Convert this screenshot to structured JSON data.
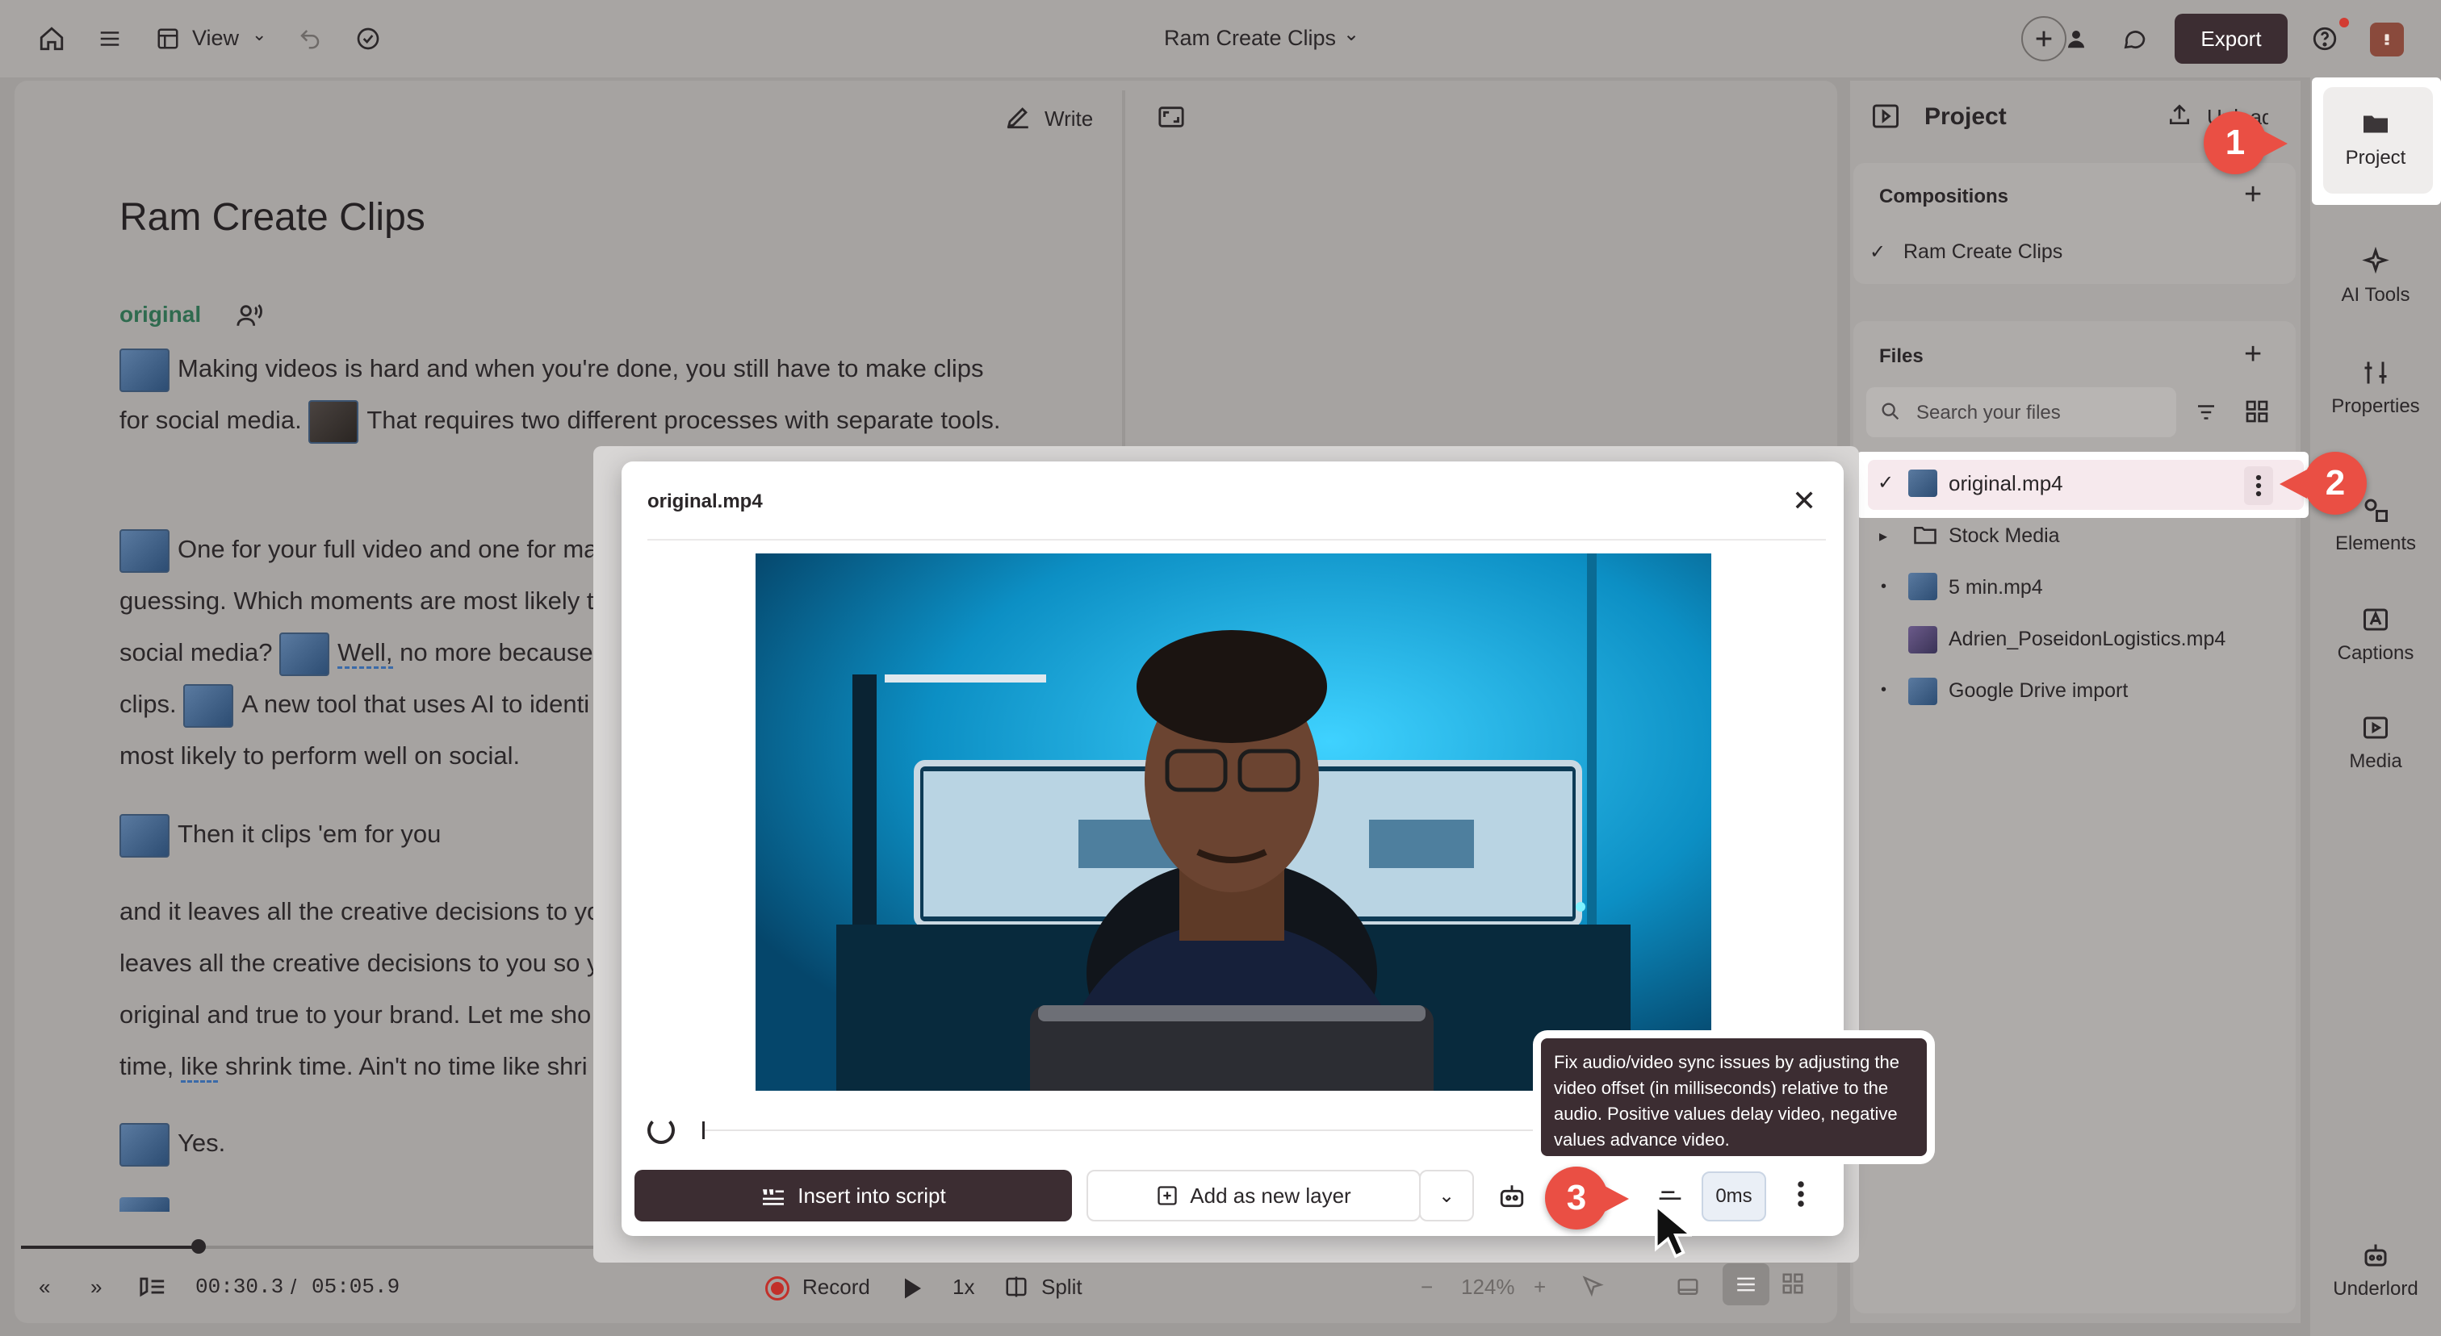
{
  "topbar": {
    "view_label": "View",
    "doc_title": "Ram Create Clips",
    "export_label": "Export"
  },
  "editor": {
    "write_label": "Write",
    "title": "Ram Create Clips",
    "speaker_label": "original",
    "p1_a": "Making videos is hard and when you're done, you still have to make clips for social media.",
    "p1_b": "That requires two different processes with separate tools.",
    "p2_a": "One for your full video and one for ma",
    "p2_b": "guessing. Which moments are most likely t",
    "p2_c": "social media?",
    "p2_d": "Well,",
    "p2_e": "no more because",
    "p2_f": "clips.",
    "p2_g": "A new tool that uses AI to identi",
    "p2_h": "most likely to perform well on social.",
    "p3": "Then it clips 'em for you",
    "p4_a": "and it leaves all the creative decisions to yo",
    "p4_b": "leaves all the creative decisions to you so y",
    "p4_c": "original and true to your brand. Let me sho",
    "p4_d": "time,",
    "p4_e": "like",
    "p4_f": "shrink time. Ain't no time like shri",
    "p5": "Yes."
  },
  "transport": {
    "current_time": "00:30.3",
    "separator": "/",
    "total_time": "05:05.9",
    "record_label": "Record",
    "speed_label": "1x",
    "split_label": "Split",
    "zoom_label": "124%",
    "progress": 0.098
  },
  "project": {
    "header": "Project",
    "upload_label": "Upload",
    "compositions_header": "Compositions",
    "compositions": [
      "Ram Create Clips"
    ],
    "files_header": "Files",
    "search_placeholder": "Search your files",
    "files": [
      {
        "name": "original.mp4"
      },
      {
        "name": "Stock Media"
      },
      {
        "name": "5 min.mp4"
      },
      {
        "name": "Adrien_PoseidonLogistics.mp4"
      },
      {
        "name": "Google Drive import"
      }
    ]
  },
  "sidebar": {
    "items": [
      "Project",
      "AI Tools",
      "Properties",
      "Elements",
      "Captions",
      "Media",
      "Underlord"
    ]
  },
  "modal": {
    "title": "original.mp4",
    "insert_label": "Insert into script",
    "add_layer_label": "Add as new layer",
    "offset_value": "0ms",
    "tooltip": "Fix audio/video sync issues by adjusting the video offset (in milliseconds) relative to the audio. Positive values delay video, negative values advance video."
  },
  "badges": [
    "1",
    "2",
    "3"
  ],
  "colors": {
    "accent_dark": "#3c2d32",
    "badge_red": "#ea4f44",
    "speaker_green": "#2f6b4f",
    "video_blue": "#1aa7d8"
  }
}
